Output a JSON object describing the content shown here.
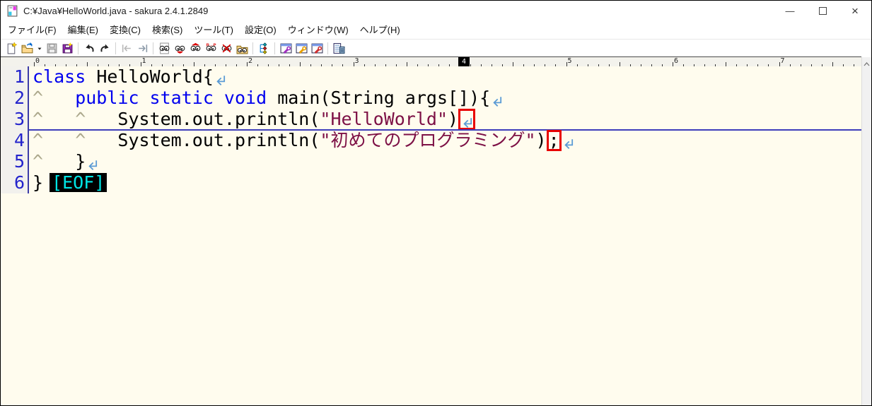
{
  "window": {
    "title": "C:¥Java¥HelloWorld.java - sakura 2.4.1.2849",
    "controls": [
      {
        "name": "minimize",
        "glyph": "—"
      },
      {
        "name": "maximize",
        "glyph": ""
      },
      {
        "name": "close",
        "glyph": "×"
      }
    ]
  },
  "menu_bar": {
    "items": [
      "ファイル(F)",
      "編集(E)",
      "変換(C)",
      "検索(S)",
      "ツール(T)",
      "設定(O)",
      "ウィンドウ(W)",
      "ヘルプ(H)"
    ]
  },
  "toolbar": {
    "groups": [
      [
        "new-file",
        "open-file",
        "open-dropdown",
        "save",
        "save-as"
      ],
      [
        "undo",
        "redo"
      ],
      [
        "jump-back",
        "jump-forward"
      ],
      [
        "search",
        "find",
        "find-next",
        "replace",
        "clear-find",
        "grep"
      ],
      [
        "outline"
      ],
      [
        "type-settings",
        "common-settings",
        "file-settings"
      ],
      [
        "special-chars"
      ]
    ]
  },
  "ruler": {
    "labels": [
      "0",
      "1",
      "2",
      "3",
      "4",
      "5",
      "6",
      "7"
    ],
    "active_label": "4",
    "active_col": 40
  },
  "editor": {
    "caret_line_index": 2,
    "lines": [
      {
        "num": "1",
        "segments": [
          {
            "k": "text",
            "s": "keyword",
            "t": "class"
          },
          {
            "k": "text",
            "s": "plain",
            "t": " HelloWorld{"
          },
          {
            "k": "arrow"
          }
        ]
      },
      {
        "num": "2",
        "segments": [
          {
            "k": "tab"
          },
          {
            "k": "text",
            "s": "keyword",
            "t": "public static void "
          },
          {
            "k": "text",
            "s": "plain",
            "t": "main(String args[]){"
          },
          {
            "k": "arrow"
          }
        ]
      },
      {
        "num": "3",
        "segments": [
          {
            "k": "tab"
          },
          {
            "k": "tab"
          },
          {
            "k": "text",
            "s": "plain",
            "t": "System.out.println("
          },
          {
            "k": "text",
            "s": "string",
            "t": "\"HelloWorld\""
          },
          {
            "k": "text",
            "s": "plain",
            "t": ")"
          },
          {
            "k": "arrow",
            "boxed": true
          }
        ]
      },
      {
        "num": "4",
        "segments": [
          {
            "k": "tab"
          },
          {
            "k": "tab"
          },
          {
            "k": "text",
            "s": "plain",
            "t": "System.out.println("
          },
          {
            "k": "text",
            "s": "string",
            "t": "\"初めてのプログラミング\""
          },
          {
            "k": "text",
            "s": "plain",
            "t": ")"
          },
          {
            "k": "text",
            "s": "plain",
            "t": ";",
            "boxed": true
          },
          {
            "k": "arrow"
          }
        ]
      },
      {
        "num": "5",
        "segments": [
          {
            "k": "tab"
          },
          {
            "k": "text",
            "s": "plain",
            "t": "}"
          },
          {
            "k": "arrow"
          }
        ]
      },
      {
        "num": "6",
        "segments": [
          {
            "k": "text",
            "s": "plain",
            "t": "}"
          },
          {
            "k": "eof",
            "t": "[EOF]"
          }
        ]
      }
    ]
  },
  "colors": {
    "keyword": "#0000ee",
    "string": "#7d1045",
    "plain": "#000000",
    "line_number": "#2323cc",
    "return_mark": "#5b9bd5",
    "tab_mark": "#aca88c",
    "eof_bg": "#000000",
    "eof_text": "#00e5e5",
    "annotation_box": "#e80000",
    "caret_line": "#3d3dbb",
    "editor_bg": "#fffcee",
    "gutter_bg": "#f2f1ed"
  }
}
